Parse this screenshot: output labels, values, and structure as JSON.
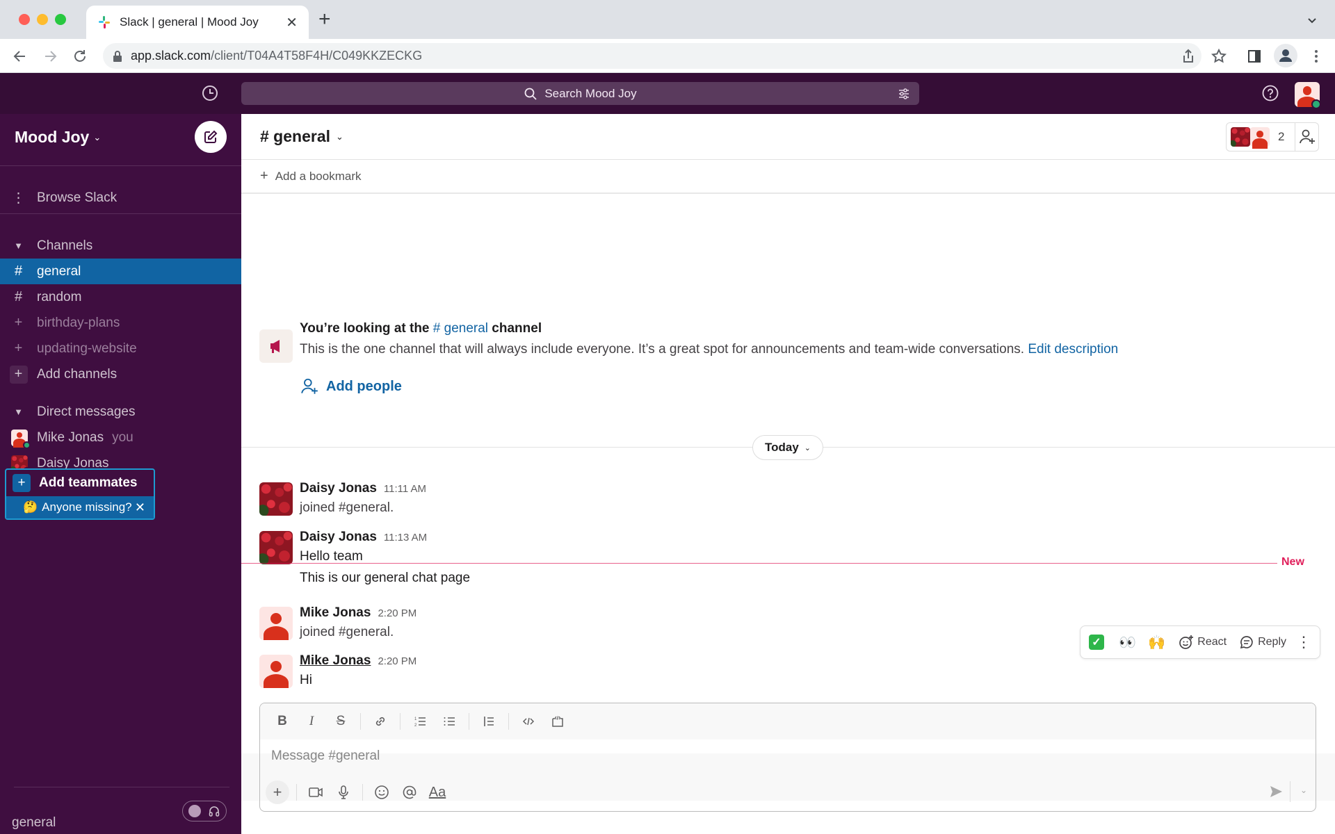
{
  "browser": {
    "tab_title": "Slack | general | Mood Joy",
    "url_host": "app.slack.com",
    "url_path": "/client/T04A4T58F4H/C049KKZECKG",
    "traffic_colors": [
      "#ff5f57",
      "#febc2e",
      "#28c840"
    ]
  },
  "topbar": {
    "search_placeholder": "Search Mood Joy"
  },
  "sidebar": {
    "workspace": "Mood Joy",
    "browse": "Browse Slack",
    "channels_header": "Channels",
    "channels": [
      {
        "label": "general",
        "prefix": "#",
        "active": true
      },
      {
        "label": "random",
        "prefix": "#",
        "active": false
      },
      {
        "label": "birthday-plans",
        "prefix": "+",
        "active": false
      },
      {
        "label": "updating-website",
        "prefix": "+",
        "active": false
      }
    ],
    "add_channels": "Add channels",
    "dm_header": "Direct messages",
    "dms": [
      {
        "label": "Mike Jonas",
        "suffix": "you"
      },
      {
        "label": "Daisy Jonas",
        "suffix": ""
      }
    ],
    "add_teammates": "Add teammates",
    "anyone_missing": "Anyone missing?",
    "anyone_missing_emoji": "🤔",
    "footer_channel": "general"
  },
  "channel": {
    "title": "# general",
    "member_count": "2",
    "add_bookmark": "Add a bookmark",
    "intro_prefix": "You’re looking at the ",
    "intro_channel": "# general",
    "intro_suffix": " channel",
    "intro_desc": "This is the one channel that will always include everyone. It’s a great spot for announcements and team-wide conversations. ",
    "edit_description": "Edit description",
    "add_people": "Add people",
    "day_divider": "Today",
    "new_label": "New"
  },
  "messages": [
    {
      "author": "Daisy Jonas",
      "time": "11:11 AM",
      "text": "joined #general.",
      "system": true
    },
    {
      "author": "Daisy Jonas",
      "time": "11:13 AM",
      "text": "Hello team",
      "system": false
    },
    {
      "author": "",
      "time": "",
      "text": "This is our general chat page",
      "system": false
    },
    {
      "author": "Mike Jonas",
      "time": "2:20 PM",
      "text": "joined #general.",
      "system": true
    },
    {
      "author": "Mike Jonas",
      "time": "2:20 PM",
      "text": "Hi",
      "system": false
    }
  ],
  "message_actions": {
    "quick_reactions": [
      "✅",
      "👀",
      "🙌"
    ],
    "react": "React",
    "reply": "Reply"
  },
  "composer": {
    "placeholder": "Message #general",
    "aa_label": "Aa"
  },
  "colors": {
    "sidebar_bg": "#3f0e40",
    "topbar_bg": "#350d36",
    "active_item": "#1164a3",
    "link": "#1264a3",
    "new_marker": "#e01e5a",
    "presence": "#2bac76"
  }
}
